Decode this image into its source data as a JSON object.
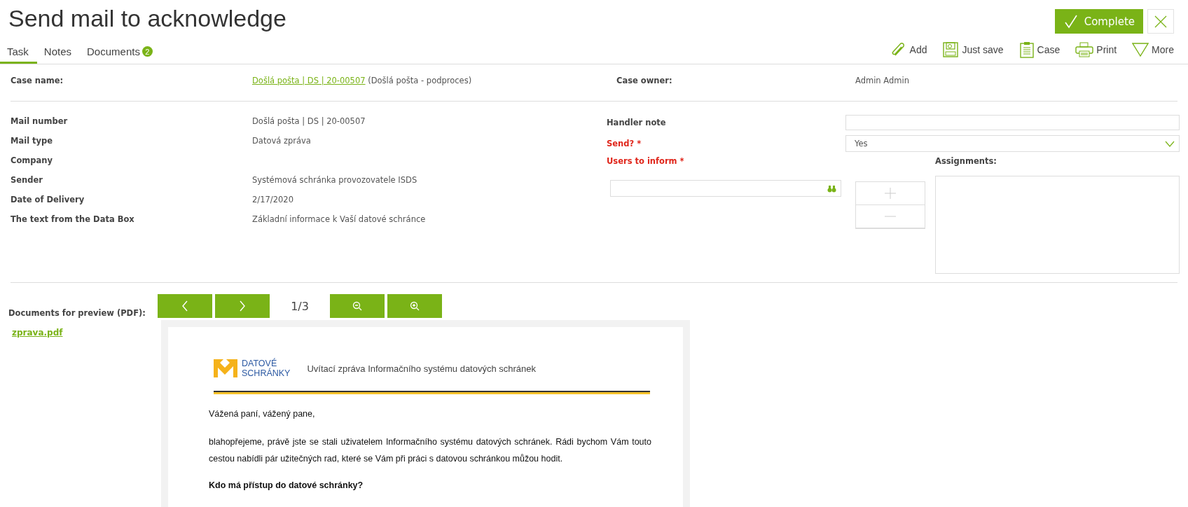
{
  "title": "Send mail to acknowledge",
  "complete": {
    "label": "Complete"
  },
  "tabs": [
    {
      "label": "Task",
      "selected": true
    },
    {
      "label": "Notes",
      "selected": false
    },
    {
      "label": "Documents",
      "selected": false,
      "badge": "2"
    }
  ],
  "toolbar": [
    {
      "kind": "paperclip",
      "label": "Add"
    },
    {
      "kind": "floppy",
      "label": "Just save"
    },
    {
      "kind": "clipboard",
      "label": "Case"
    },
    {
      "kind": "printer",
      "label": "Print"
    },
    {
      "kind": "triangle",
      "label": "More"
    }
  ],
  "case": {
    "label": "Case name:",
    "link": "Došlá pošta | DS | 20-00507",
    "suffix": "(Došlá pošta - podproces)",
    "owner_label": "Case owner:",
    "owner": "Admin Admin"
  },
  "fields": [
    {
      "label": "Mail number",
      "value": "Došlá pošta | DS | 20-00507"
    },
    {
      "label": "Mail type",
      "value": "Datová zpráva"
    },
    {
      "label": "Company"
    },
    {
      "label": "Sender",
      "value": "Systémová schránka provozovatele ISDS"
    },
    {
      "label": "Date of Delivery",
      "value": "2/17/2020"
    },
    {
      "label": "The text from the Data Box",
      "value": "Základní informace k Vaší datové schránce"
    }
  ],
  "handler_note": {
    "label": "Handler note",
    "required": false
  },
  "send": {
    "label": "Send? *",
    "required": true,
    "value": "Yes"
  },
  "users_to_inform": {
    "label": "Users to inform *",
    "required": true
  },
  "assignments": {
    "label": "Assignments:"
  },
  "preview": {
    "label": "Documents for preview (PDF):",
    "file": "zprava.pdf",
    "page": "1/3",
    "logo": [
      "DATOVÉ",
      "SCHRÁNKY"
    ],
    "heading": "Uvítací zpráva Informačního systému datových schránek",
    "paragraphs": [
      {
        "kind": "text",
        "text": "Vážená paní, vážený pane,"
      },
      {
        "kind": "text",
        "text": "blahopřejeme, právě jste se stali uživatelem Informačního systému datových schránek. Rádi bychom Vám touto cestou nabídli pár užitečných rad, které se Vám při práci s datovou schránkou můžou hodit."
      },
      {
        "kind": "heading",
        "text": "Kdo má přístup do datové schránky?"
      }
    ]
  }
}
